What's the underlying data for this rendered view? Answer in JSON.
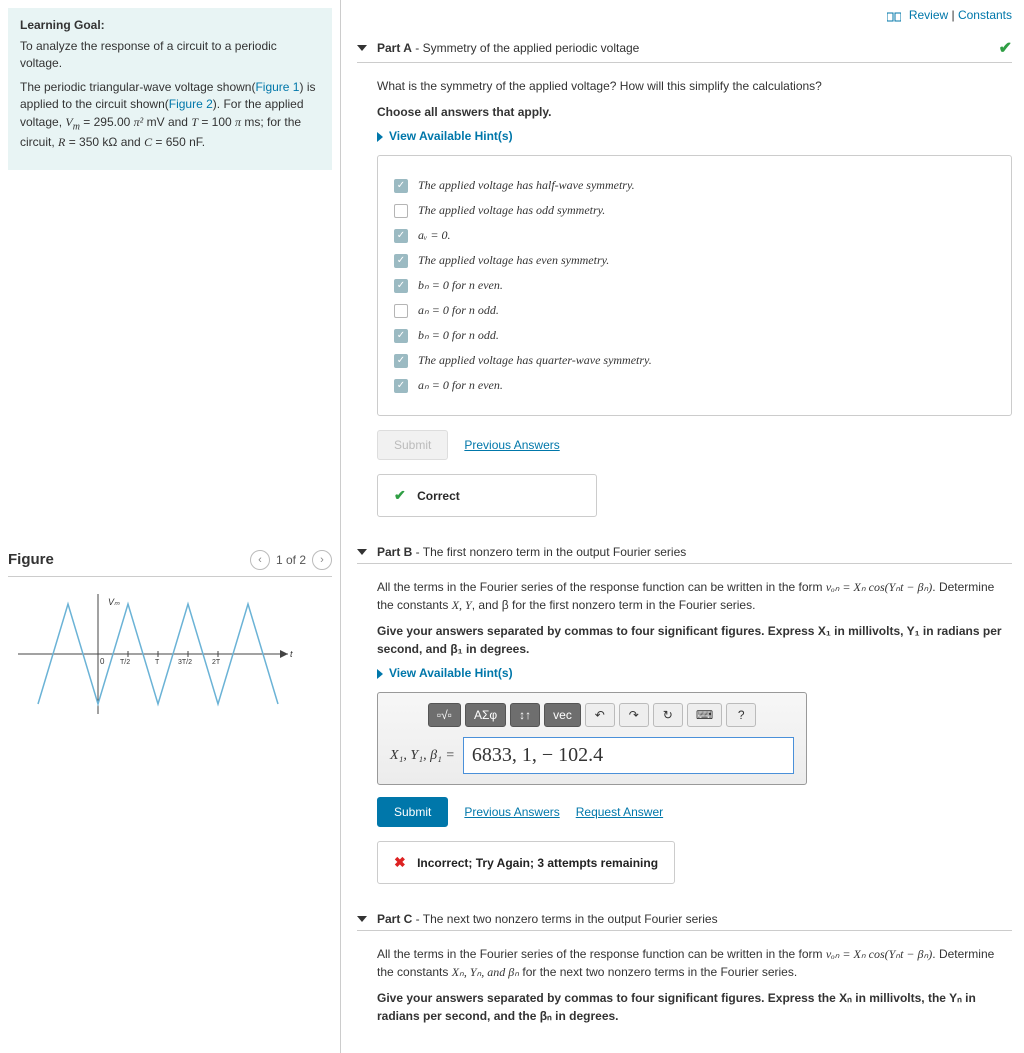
{
  "top": {
    "review": "Review",
    "constants": "Constants"
  },
  "goal": {
    "heading": "Learning Goal:",
    "p1": "To analyze the response of a circuit to a periodic voltage.",
    "p2a": "The periodic triangular-wave voltage shown(",
    "fig1": "Figure 1",
    "p2b": ") is applied to the circuit shown(",
    "fig2": "Figure 2",
    "p2c": "). For the applied voltage, ",
    "vm_var": "V",
    "vm_sub": "m",
    "vm_eq": " = 295.00 ",
    "pi2": "π²",
    "vm_unit": " mV and ",
    "t_var": "T",
    "t_eq": " = 100 ",
    "pi": "π",
    "t_unit": " ms; for the circuit, ",
    "r_var": "R",
    "r_eq": " = 350 kΩ and ",
    "c_var": "C",
    "c_eq": " = 650 nF."
  },
  "figure": {
    "title": "Figure",
    "counter": "1 of 2"
  },
  "partA": {
    "label": "Part A",
    "dash": " - ",
    "subtitle": "Symmetry of the applied periodic voltage",
    "q": "What is the symmetry of the applied voltage? How will this simplify the calculations?",
    "choose": "Choose all answers that apply.",
    "hints": "View Available Hint(s)",
    "choices": [
      {
        "checked": true,
        "text": "The applied voltage has half-wave symmetry."
      },
      {
        "checked": false,
        "text": "The applied voltage has odd symmetry."
      },
      {
        "checked": true,
        "text": "aᵥ = 0."
      },
      {
        "checked": true,
        "text": "The applied voltage has even symmetry."
      },
      {
        "checked": true,
        "text": "bₙ = 0 for n even."
      },
      {
        "checked": false,
        "text": "aₙ = 0 for n odd."
      },
      {
        "checked": true,
        "text": "bₙ = 0 for n odd."
      },
      {
        "checked": true,
        "text": "The applied voltage has quarter-wave symmetry."
      },
      {
        "checked": true,
        "text": "aₙ = 0 for n even."
      }
    ],
    "submit": "Submit",
    "prev": "Previous Answers",
    "feedback": "Correct"
  },
  "partB": {
    "label": "Part B",
    "dash": " - ",
    "subtitle": "The first nonzero term in the output Fourier series",
    "q1a": "All the terms in the Fourier series of the response function can be written in the form ",
    "q1b": ". Determine the constants ",
    "q1c": ", and β for the first nonzero term in the Fourier series.",
    "formula": "vₒₙ = Xₙ cos(Yₙt − βₙ)",
    "xy": "X, Y",
    "instr": "Give your answers separated by commas to four significant figures. Express X₁ in millivolts, Y₁ in radians per second, and β₁ in degrees.",
    "hints": "View Available Hint(s)",
    "toolbar": {
      "t1": "▫√▫",
      "t2": "ΑΣφ",
      "t3": "↕↑",
      "t4": "vec",
      "t5": "↶",
      "t6": "↷",
      "t7": "↻",
      "t8": "⌨",
      "t9": "?"
    },
    "input_label": "X₁, Y₁, β₁ = ",
    "input_value": "6833, 1, − 102.4",
    "submit": "Submit",
    "prev": "Previous Answers",
    "req": "Request Answer",
    "feedback": "Incorrect; Try Again; 3 attempts remaining"
  },
  "partC": {
    "label": "Part C",
    "dash": " - ",
    "subtitle": "The next two nonzero terms in the output Fourier series",
    "q1a": "All the terms in the Fourier series of the response function can be written in the form ",
    "q1b": ". Determine the constants ",
    "q1c": " for the next two nonzero terms in the Fourier series.",
    "formula": "vₒₙ = Xₙ cos(Yₙt − βₙ)",
    "xyb": "Xₙ, Yₙ, and βₙ",
    "instr": "Give your answers separated by commas to four significant figures. Express the Xₙ in millivolts, the Yₙ in radians per second, and the βₙ in degrees."
  }
}
